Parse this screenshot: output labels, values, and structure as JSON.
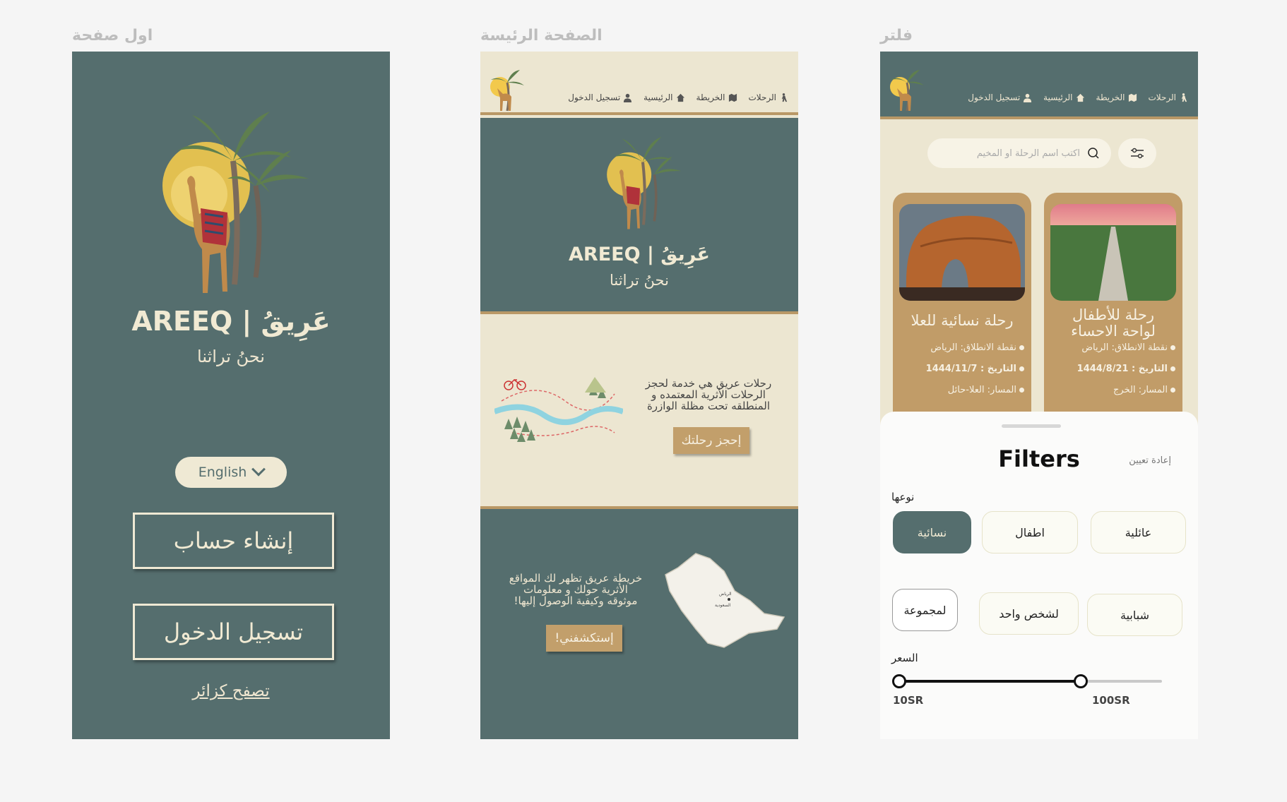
{
  "frames": {
    "first_page_title": "اول صفحة",
    "home_page_title": "الصفحة الرئيسة",
    "filter_page_title": "فلتر"
  },
  "brand": {
    "name": "AREEQ | عَرِيقُ",
    "tagline": "نحنُ تراثنا"
  },
  "welcome": {
    "language": "English",
    "create_account": "إنشاء حساب",
    "login": "تسجيل الدخول",
    "guest": "تصفح كزائر"
  },
  "nav": {
    "login": "تسجيل الدخول",
    "home": "الرئيسية",
    "map": "الخريطة",
    "trips": "الرحلات"
  },
  "home": {
    "trips_promo_lines": [
      "رحلات عريق هي خدمة لحجز",
      "الرحلات الأثرية المعتمده و",
      "المنطلقه تحت مظلة الوازرة"
    ],
    "book_button": "إحجز رحلتك",
    "map_promo_lines": [
      "خريطة عريق تظهر لك المواقع",
      "الأثرية حولك و معلومات",
      "موثوقه وكيفية الوصول إليها!"
    ],
    "explore_button": "إستكشفني!",
    "map_labels": [
      "الرياض",
      "السعودية"
    ]
  },
  "filter": {
    "search_placeholder": "اكتب اسم الرحلة او المخيم",
    "cards": [
      {
        "title_lines": [
          "رحلة للأطفال",
          "لواحة الاحساء"
        ],
        "start": "نقطة الانطلاق: الرياض",
        "date": "التاريخ : 1444/8/21",
        "route": "المسار: الخرج"
      },
      {
        "title_lines": [
          "رحلة نسائية للعلا"
        ],
        "start": "نقطة الانطلاق: الرياض",
        "date": "التاريخ : 1444/11/7",
        "route": "المسار: العلا-حائل"
      }
    ],
    "sheet_title": "Filters",
    "reset": "إعادة تعيين",
    "type_label": "نوعها",
    "chips_row1": [
      "عائلية",
      "اطفال",
      "نسائية"
    ],
    "chips_row2": [
      "شبابية",
      "لشخص واحد",
      "لمجموعة"
    ],
    "active_chip": "نسائية",
    "price_label": "السعر",
    "price_min": "10SR",
    "price_max": "100SR",
    "price_range_fraction": [
      0,
      0.69
    ]
  },
  "colors": {
    "teal": "#556e6e",
    "cream": "#ece6d1",
    "tan": "#c19c68",
    "gold_line": "#b99866"
  }
}
